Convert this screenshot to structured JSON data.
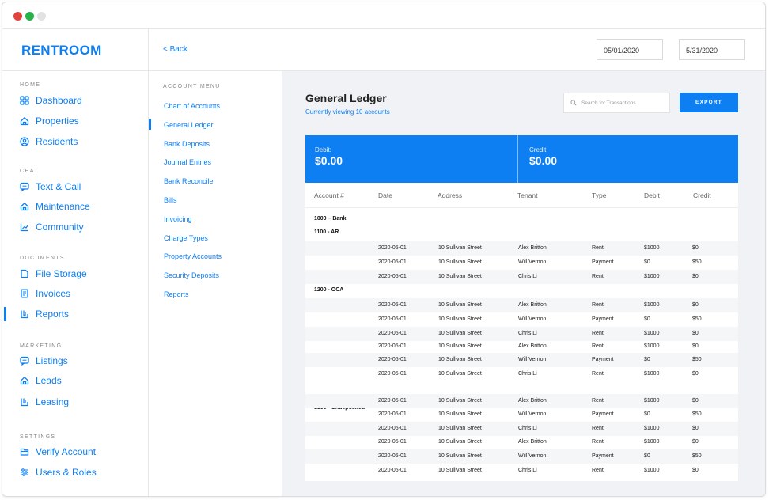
{
  "window": {
    "dots": [
      {
        "name": "close-dot",
        "color": "#e0443c"
      },
      {
        "name": "minimize-dot",
        "color": "#27b34a"
      },
      {
        "name": "maximize-dot",
        "color": "#e2e2e2"
      }
    ]
  },
  "brand": {
    "logo": "RENTROOM",
    "accent": "#0d7ff2"
  },
  "topbar": {
    "back_label": "< Back",
    "start_date": "05/01/2020",
    "end_date": "5/31/2020"
  },
  "sidebar": {
    "sections": {
      "home": "HOME",
      "chat": "CHAT",
      "documents": "DOCUMENTS",
      "marketing": "MARKETING",
      "settings": "SETTINGS"
    },
    "items": {
      "dashboard": {
        "label": "Dashboard",
        "icon": "grid-icon"
      },
      "properties": {
        "label": "Properties",
        "icon": "home-icon"
      },
      "residents": {
        "label": "Residents",
        "icon": "user-circle-icon"
      },
      "text_call": {
        "label": "Text & Call",
        "icon": "chat-icon"
      },
      "maintenance": {
        "label": "Maintenance",
        "icon": "home-icon"
      },
      "community": {
        "label": "Community",
        "icon": "chart-icon"
      },
      "file_storage": {
        "label": "File Storage",
        "icon": "file-icon"
      },
      "invoices": {
        "label": "Invoices",
        "icon": "invoice-icon"
      },
      "reports": {
        "label": "Reports",
        "icon": "report-icon",
        "active": true
      },
      "listings": {
        "label": "Listings",
        "icon": "chat-icon"
      },
      "leads": {
        "label": "Leads",
        "icon": "home-icon"
      },
      "leasing": {
        "label": "Leasing",
        "icon": "report-icon"
      },
      "verify_account": {
        "label": "Verify Account",
        "icon": "folder-icon"
      },
      "users_roles": {
        "label": "Users & Roles",
        "icon": "sliders-icon"
      }
    }
  },
  "account_menu": {
    "title": "ACCOUNT MENU",
    "items": [
      "Chart of Accounts",
      "General Ledger",
      "Bank Deposits",
      "Journal Entries",
      "Bank Reconcile",
      "Bills",
      "Invoicing",
      "Charge Types",
      "Property Accounts",
      "Security Deposits",
      "Reports"
    ],
    "active_index": 1
  },
  "main": {
    "title": "General Ledger",
    "subtitle": "Currently viewing 10 accounts",
    "search_placeholder": "Search for Transactions",
    "export_label": "EXPORT",
    "debit_label": "Debit:",
    "debit_value": "$0.00",
    "credit_label": "Credit:",
    "credit_value": "$0.00"
  },
  "ledger": {
    "columns": [
      "Account #",
      "Date",
      "Address",
      "Tenant",
      "Type",
      "Debit",
      "Credit"
    ],
    "groups": [
      {
        "label": "1000 – Bank",
        "rows": []
      },
      {
        "label": "1100 - AR",
        "rows": [
          [
            "2020-05-01",
            "10 Sullivan Street",
            "Alex Britton",
            "Rent",
            "$1000",
            "$0"
          ],
          [
            "2020-05-01",
            "10 Sullivan Street",
            "Will Vernon",
            "Payment",
            "$0",
            "$50"
          ],
          [
            "2020-05-01",
            "10 Sullivan Street",
            "Chris Li",
            "Rent",
            "$1000",
            "$0"
          ]
        ]
      },
      {
        "label": "1200 - OCA",
        "rows": [
          [
            "2020-05-01",
            "10 Sullivan Street",
            "Alex Britton",
            "Rent",
            "$1000",
            "$0"
          ],
          [
            "2020-05-01",
            "10 Sullivan Street",
            "Will Vernon",
            "Payment",
            "$0",
            "$50"
          ],
          [
            "2020-05-01",
            "10 Sullivan Street",
            "Chris Li",
            "Rent",
            "$1000",
            "$0"
          ],
          [
            "2020-05-01",
            "10 Sullivan Street",
            "Alex Britton",
            "Rent",
            "$1000",
            "$0"
          ],
          [
            "2020-05-01",
            "10 Sullivan Street",
            "Will Vernon",
            "Payment",
            "$0",
            "$50"
          ],
          [
            "2020-05-01",
            "10 Sullivan Street",
            "Chris Li",
            "Rent",
            "$1000",
            "$0"
          ]
        ]
      },
      {
        "label": "1300 - Undeposited",
        "rows": [
          [
            "2020-05-01",
            "10 Sullivan Street",
            "Alex Britton",
            "Rent",
            "$1000",
            "$0"
          ],
          [
            "2020-05-01",
            "10 Sullivan Street",
            "Will Vernon",
            "Payment",
            "$0",
            "$50"
          ],
          [
            "2020-05-01",
            "10 Sullivan Street",
            "Chris Li",
            "Rent",
            "$1000",
            "$0"
          ],
          [
            "2020-05-01",
            "10 Sullivan Street",
            "Alex Britton",
            "Rent",
            "$1000",
            "$0"
          ],
          [
            "2020-05-01",
            "10 Sullivan Street",
            "Will Vernon",
            "Payment",
            "$0",
            "$50"
          ],
          [
            "2020-05-01",
            "10 Sullivan Street",
            "Chris Li",
            "Rent",
            "$1000",
            "$0"
          ]
        ]
      }
    ]
  }
}
